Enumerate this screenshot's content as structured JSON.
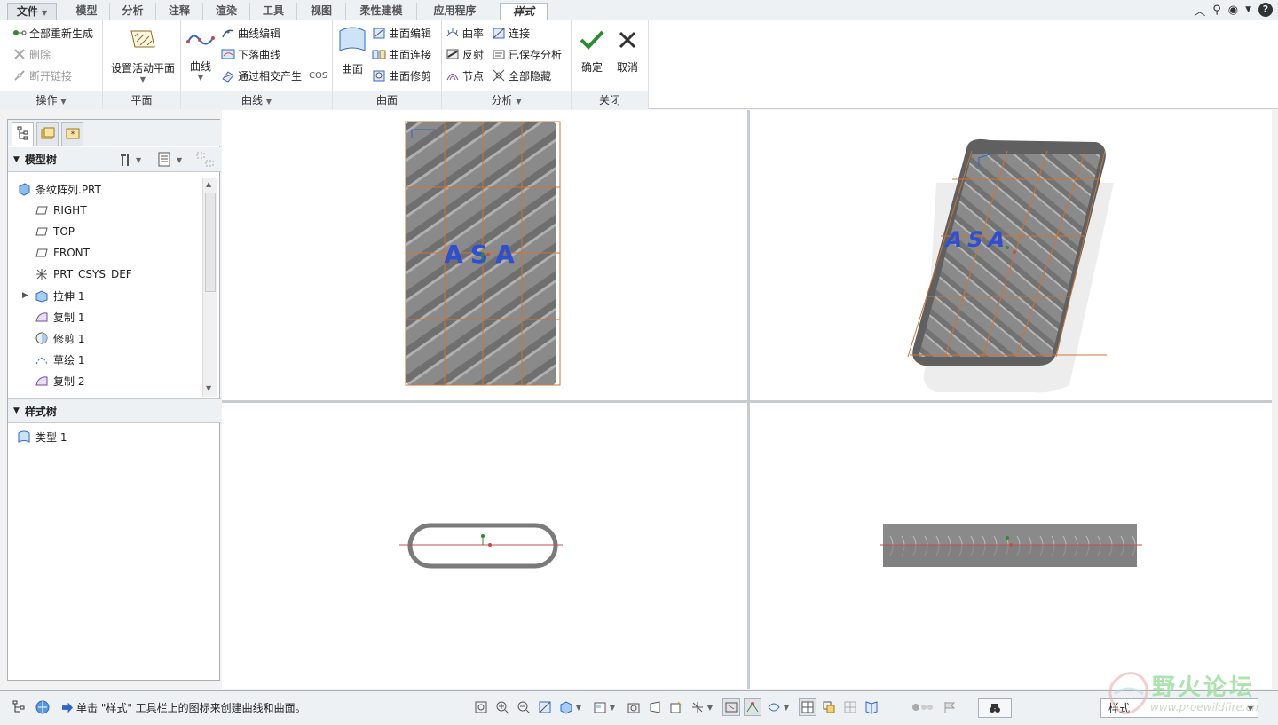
{
  "tabs": [
    "文件",
    "模型",
    "分析",
    "注释",
    "渲染",
    "工具",
    "视图",
    "柔性建模",
    "应用程序",
    "样式"
  ],
  "ribbon": {
    "operations": {
      "label": "操作",
      "items": [
        "全部重新生成",
        "删除",
        "断开链接"
      ]
    },
    "plane": {
      "label": "平面",
      "button": "设置活动平面"
    },
    "curve": {
      "label": "曲线",
      "button": "曲线",
      "items": [
        "曲线编辑",
        "下落曲线",
        "通过相交产生"
      ],
      "cos": "COS"
    },
    "surface": {
      "label": "曲面",
      "button": "曲面",
      "items": [
        "曲面编辑",
        "曲面连接",
        "曲面修剪"
      ]
    },
    "analysis": {
      "label": "分析",
      "items_left": [
        "曲率",
        "反射",
        "节点"
      ],
      "items_right": [
        "连接",
        "已保存分析",
        "全部隐藏"
      ]
    },
    "close": {
      "label": "关闭",
      "ok": "确定",
      "cancel": "取消"
    }
  },
  "model_tree": {
    "header": "模型树",
    "items": [
      {
        "label": "条纹阵列.PRT",
        "icon": "part-icon"
      },
      {
        "label": "RIGHT",
        "icon": "datum-plane-icon"
      },
      {
        "label": "TOP",
        "icon": "datum-plane-icon"
      },
      {
        "label": "FRONT",
        "icon": "datum-plane-icon"
      },
      {
        "label": "PRT_CSYS_DEF",
        "icon": "csys-icon"
      },
      {
        "label": "拉伸 1",
        "icon": "extrude-icon"
      },
      {
        "label": "复制 1",
        "icon": "copy-icon"
      },
      {
        "label": "修剪 1",
        "icon": "trim-icon"
      },
      {
        "label": "草绘 1",
        "icon": "sketch-icon"
      },
      {
        "label": "复制 2",
        "icon": "copy-icon"
      }
    ]
  },
  "style_tree": {
    "header": "样式树",
    "items": [
      {
        "label": "类型 1",
        "icon": "style-type-icon"
      }
    ]
  },
  "viewport": {
    "logo_text": "ASA"
  },
  "status": {
    "message": "单击 \"样式\" 工具栏上的图标来创建曲线和曲面。",
    "filter": "样式"
  },
  "watermark": {
    "title": "野火论坛",
    "url": "www.proewildfire.cn"
  },
  "colors": {
    "accent": "#2f66c8",
    "curve_red": "#c0504d",
    "ok_green": "#2e8b2e",
    "model_gray": "#7a7a7a",
    "grid_orange": "#c8763a"
  }
}
